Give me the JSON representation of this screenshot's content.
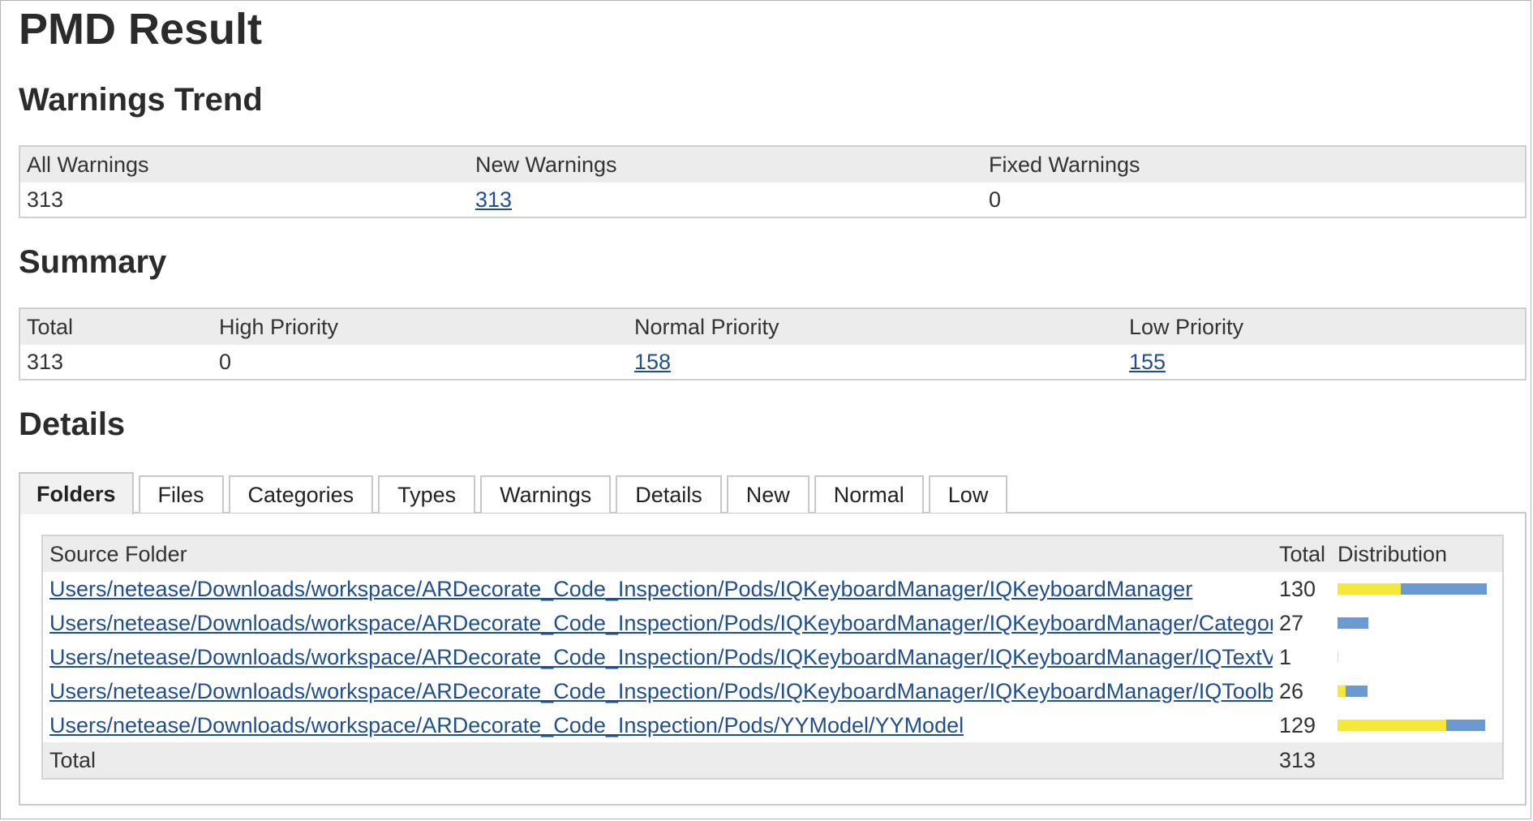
{
  "page": {
    "title": "PMD Result"
  },
  "trend": {
    "heading": "Warnings Trend",
    "columns": [
      "All Warnings",
      "New Warnings",
      "Fixed Warnings"
    ],
    "values": {
      "all": "313",
      "new": "313",
      "fixed": "0"
    }
  },
  "summary": {
    "heading": "Summary",
    "columns": [
      "Total",
      "High Priority",
      "Normal Priority",
      "Low Priority"
    ],
    "values": {
      "total": "313",
      "high": "0",
      "normal": "158",
      "low": "155"
    }
  },
  "details": {
    "heading": "Details",
    "tabs": [
      "Folders",
      "Files",
      "Categories",
      "Types",
      "Warnings",
      "Details",
      "New",
      "Normal",
      "Low"
    ],
    "active_tab": "Folders",
    "table": {
      "columns": [
        "Source Folder",
        "Total",
        "Distribution"
      ],
      "rows": [
        {
          "folder": "Users/netease/Downloads/workspace/ARDecorate_Code_Inspection/Pods/IQKeyboardManager/IQKeyboardManager",
          "total": "130",
          "normal": 55,
          "low": 75
        },
        {
          "folder": "Users/netease/Downloads/workspace/ARDecorate_Code_Inspection/Pods/IQKeyboardManager/IQKeyboardManager/Categories",
          "total": "27",
          "normal": 0,
          "low": 27
        },
        {
          "folder": "Users/netease/Downloads/workspace/ARDecorate_Code_Inspection/Pods/IQKeyboardManager/IQKeyboardManager/IQTextView",
          "total": "1",
          "normal": 1,
          "low": 0
        },
        {
          "folder": "Users/netease/Downloads/workspace/ARDecorate_Code_Inspection/Pods/IQKeyboardManager/IQKeyboardManager/IQToolbar",
          "total": "26",
          "normal": 7,
          "low": 19
        },
        {
          "folder": "Users/netease/Downloads/workspace/ARDecorate_Code_Inspection/Pods/YYModel/YYModel",
          "total": "129",
          "normal": 95,
          "low": 34
        }
      ],
      "total_label": "Total",
      "total_value": "313"
    }
  },
  "colors": {
    "normal_priority": "#f6e83a",
    "low_priority": "#6a9ad1",
    "link": "#1f4f8f"
  }
}
